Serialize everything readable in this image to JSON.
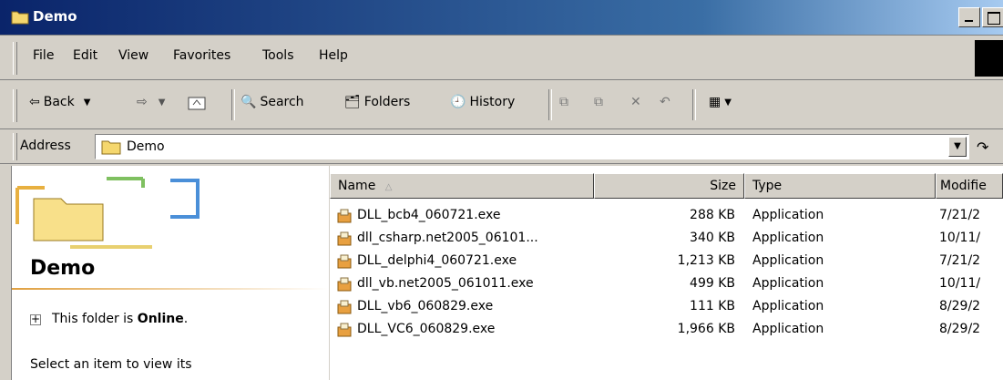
{
  "window": {
    "title": "Demo"
  },
  "menu": [
    "File",
    "Edit",
    "View",
    "Favorites",
    "Tools",
    "Help"
  ],
  "toolbar": {
    "back": "Back",
    "search": "Search",
    "folders": "Folders",
    "history": "History"
  },
  "address": {
    "label": "Address",
    "value": "Demo"
  },
  "leftpane": {
    "title": "Demo",
    "online_prefix": "This folder is ",
    "online_status": "Online",
    "online_suffix": ".",
    "select_hint": "Select an item to view its"
  },
  "columns": {
    "name": "Name",
    "size": "Size",
    "type": "Type",
    "modified": "Modifie"
  },
  "files": [
    {
      "name": "DLL_bcb4_060721.exe",
      "size": "288 KB",
      "type": "Application",
      "modified": "7/21/2"
    },
    {
      "name": "dll_csharp.net2005_06101...",
      "size": "340 KB",
      "type": "Application",
      "modified": "10/11/"
    },
    {
      "name": "DLL_delphi4_060721.exe",
      "size": "1,213 KB",
      "type": "Application",
      "modified": "7/21/2"
    },
    {
      "name": "dll_vb.net2005_061011.exe",
      "size": "499 KB",
      "type": "Application",
      "modified": "10/11/"
    },
    {
      "name": "DLL_vb6_060829.exe",
      "size": "111 KB",
      "type": "Application",
      "modified": "8/29/2"
    },
    {
      "name": "DLL_VC6_060829.exe",
      "size": "1,966 KB",
      "type": "Application",
      "modified": "8/29/2"
    }
  ]
}
